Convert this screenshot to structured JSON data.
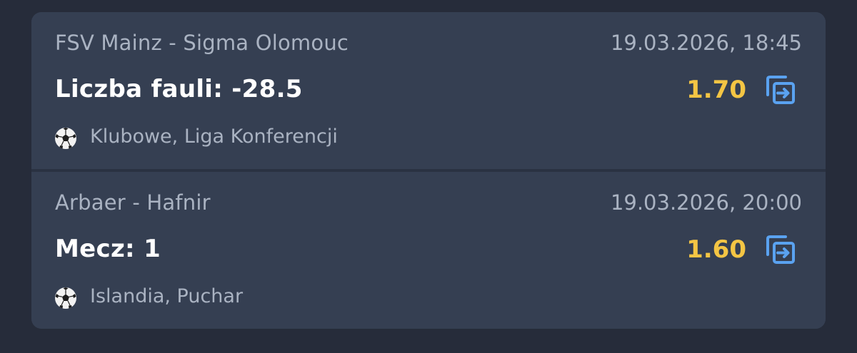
{
  "bets": [
    {
      "match": "FSV Mainz - Sigma Olomouc",
      "datetime": "19.03.2026, 18:45",
      "selection": "Liczba fauli: -28.5",
      "odds": "1.70",
      "sport_icon": "soccer-ball-icon",
      "league": "Klubowe, Liga Konferencji",
      "action_icon": "copy-to-slip-icon"
    },
    {
      "match": "Arbaer - Hafnir",
      "datetime": "19.03.2026, 20:00",
      "selection": "Mecz: 1",
      "odds": "1.60",
      "sport_icon": "soccer-ball-icon",
      "league": "Islandia, Puchar",
      "action_icon": "copy-to-slip-icon"
    }
  ],
  "colors": {
    "background": "#262c3a",
    "card": "#353f52",
    "odds": "#f4c544",
    "icon_accent": "#5aa2f0",
    "secondary_text": "#aab3c2",
    "primary_text": "#ffffff"
  }
}
